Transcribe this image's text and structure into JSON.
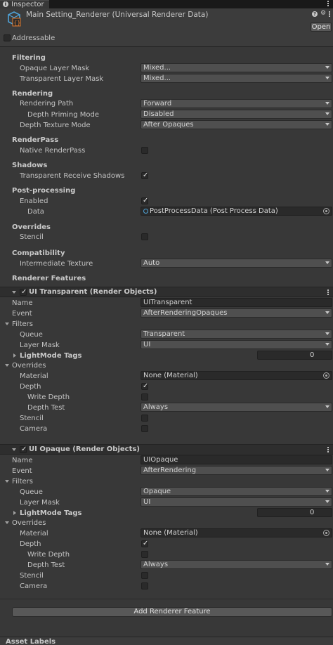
{
  "tab": {
    "label": "Inspector"
  },
  "header": {
    "title": "Main Setting_Renderer (Universal Renderer Data)",
    "open_label": "Open",
    "addressable_label": "Addressable"
  },
  "filtering": {
    "heading": "Filtering",
    "opaque_label": "Opaque Layer Mask",
    "opaque_value": "Mixed...",
    "transparent_label": "Transparent Layer Mask",
    "transparent_value": "Mixed..."
  },
  "rendering": {
    "heading": "Rendering",
    "path_label": "Rendering Path",
    "path_value": "Forward",
    "priming_label": "Depth Priming Mode",
    "priming_value": "Disabled",
    "depth_tex_label": "Depth Texture Mode",
    "depth_tex_value": "After Opaques"
  },
  "renderpass": {
    "heading": "RenderPass",
    "native_label": "Native RenderPass",
    "native_checked": false
  },
  "shadows": {
    "heading": "Shadows",
    "receive_label": "Transparent Receive Shadows",
    "receive_checked": true
  },
  "postprocessing": {
    "heading": "Post-processing",
    "enabled_label": "Enabled",
    "enabled_checked": true,
    "data_label": "Data",
    "data_value": "PostProcessData (Post Process Data)"
  },
  "overrides": {
    "heading": "Overrides",
    "stencil_label": "Stencil",
    "stencil_checked": false
  },
  "compatibility": {
    "heading": "Compatibility",
    "intermediate_label": "Intermediate Texture",
    "intermediate_value": "Auto"
  },
  "renderer_features_heading": "Renderer Features",
  "features": [
    {
      "title": "UI Transparent (Render Objects)",
      "name_label": "Name",
      "name_value": "UITransparent",
      "event_label": "Event",
      "event_value": "AfterRenderingOpaques",
      "filters_label": "Filters",
      "queue_label": "Queue",
      "queue_value": "Transparent",
      "layer_label": "Layer Mask",
      "layer_value": "UI",
      "tags_label": "LightMode Tags",
      "tags_value": "0",
      "overrides_label": "Overrides",
      "material_label": "Material",
      "material_value": "None (Material)",
      "depth_label": "Depth",
      "depth_checked": true,
      "write_depth_label": "Write Depth",
      "write_depth_checked": false,
      "depth_test_label": "Depth Test",
      "depth_test_value": "Always",
      "stencil_label": "Stencil",
      "camera_label": "Camera"
    },
    {
      "title": "UI Opaque (Render Objects)",
      "name_label": "Name",
      "name_value": "UIOpaque",
      "event_label": "Event",
      "event_value": "AfterRendering",
      "filters_label": "Filters",
      "queue_label": "Queue",
      "queue_value": "Opaque",
      "layer_label": "Layer Mask",
      "layer_value": "UI",
      "tags_label": "LightMode Tags",
      "tags_value": "0",
      "overrides_label": "Overrides",
      "material_label": "Material",
      "material_value": "None (Material)",
      "depth_label": "Depth",
      "depth_checked": true,
      "write_depth_label": "Write Depth",
      "write_depth_checked": false,
      "depth_test_label": "Depth Test",
      "depth_test_value": "Always",
      "stencil_label": "Stencil",
      "camera_label": "Camera"
    }
  ],
  "add_feature_label": "Add Renderer Feature",
  "footer": {
    "asset_labels": "Asset Labels"
  },
  "icons": [
    "info-icon",
    "kebab-icon",
    "help-icon",
    "settings-icon",
    "asset-script-icon",
    "object-picker-icon",
    "checkmark-icon",
    "foldout-arrow-icon",
    "dropdown-arrow-icon"
  ],
  "colors": {
    "background": "#383838",
    "header": "#3c3c3c",
    "field": "#2a2a2a",
    "dropdown": "#4f4f4f",
    "button": "#585858",
    "accent": "#4fa3d8"
  }
}
